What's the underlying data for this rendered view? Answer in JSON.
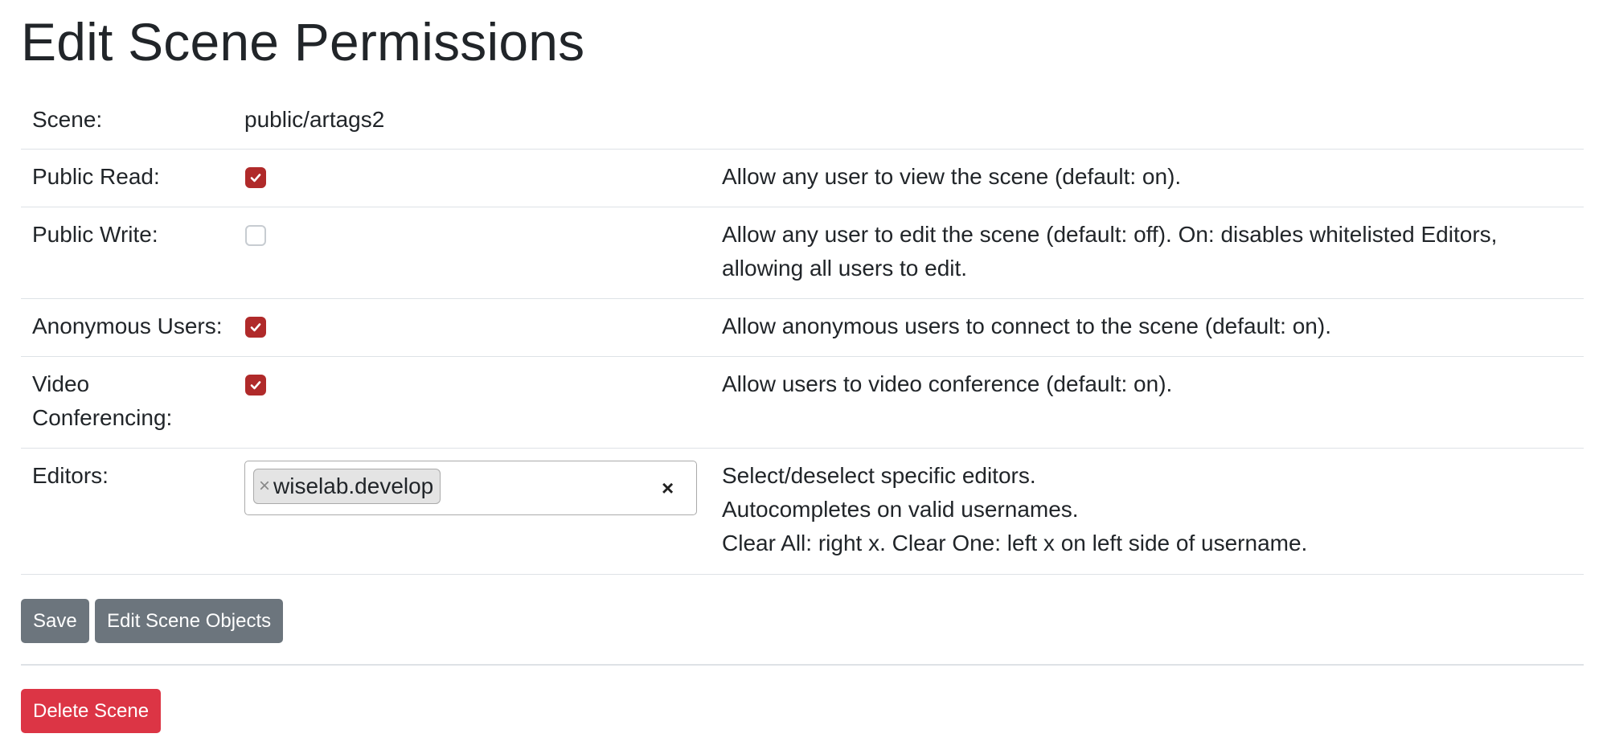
{
  "page": {
    "title": "Edit Scene Permissions"
  },
  "rows": {
    "scene": {
      "label": "Scene:",
      "value": "public/artags2"
    },
    "public_read": {
      "label": "Public Read:",
      "checked": true,
      "description": "Allow any user to view the scene (default: on)."
    },
    "public_write": {
      "label": "Public Write:",
      "checked": false,
      "description": "Allow any user to edit the scene (default: off). On: disables whitelisted Editors, allowing all users to edit."
    },
    "anonymous_users": {
      "label": "Anonymous Users:",
      "checked": true,
      "description": "Allow anonymous users to connect to the scene (default: on)."
    },
    "video_conferencing": {
      "label": "Video Conferencing:",
      "checked": true,
      "description": "Allow users to video conference (default: on)."
    },
    "editors": {
      "label": "Editors:",
      "selected": [
        "wiselab.develop"
      ],
      "chip_remove_glyph": "×",
      "clear_all_glyph": "×",
      "description_lines": [
        "Select/deselect specific editors.",
        "Autocompletes on valid usernames.",
        "Clear All: right x. Clear One: left x on left side of username."
      ]
    }
  },
  "buttons": {
    "save": "Save",
    "edit_objects": "Edit Scene Objects",
    "delete": "Delete Scene"
  },
  "colors": {
    "checkbox_checked": "#b02a2a",
    "button_secondary": "#6c757d",
    "button_danger": "#dc3545"
  }
}
